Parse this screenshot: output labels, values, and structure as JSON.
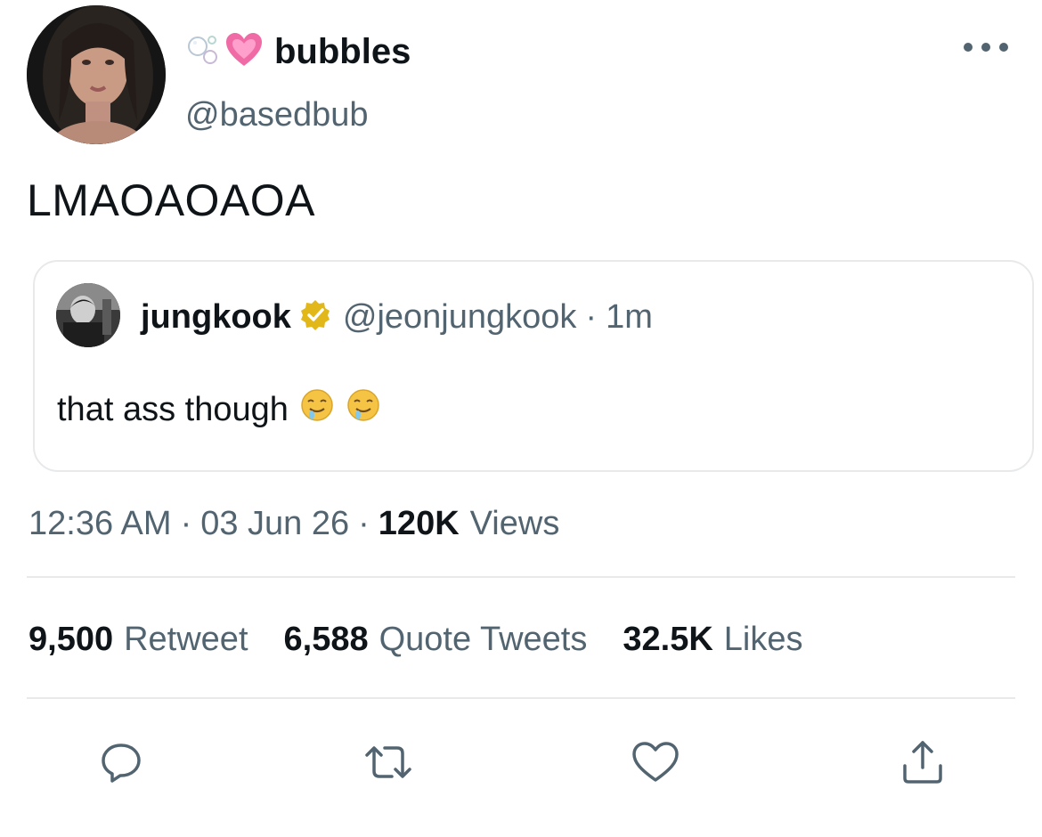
{
  "author": {
    "display_name": "bubbles",
    "handle": "@basedbub",
    "name_emojis": [
      "bubbles-emoji",
      "growing-heart-emoji"
    ]
  },
  "tweet": {
    "text": "LMAOAOAOA"
  },
  "quoted_tweet": {
    "display_name": "jungkook",
    "verified": true,
    "handle": "@jeonjungkook",
    "separator": "·",
    "time": "1m",
    "text": "that ass though",
    "emojis": [
      "drooling-face-emoji",
      "drooling-face-emoji"
    ]
  },
  "meta": {
    "time": "12:36 AM",
    "separator": "·",
    "date": "03 Jun 26",
    "views_count": "120K",
    "views_label": "Views"
  },
  "stats": {
    "retweets_count": "9,500",
    "retweets_label": "Retweet",
    "quotes_count": "6,588",
    "quotes_label": "Quote Tweets",
    "likes_count": "32.5K",
    "likes_label": "Likes"
  },
  "colors": {
    "text_primary": "#0f1419",
    "text_secondary": "#536471",
    "border": "#e7e9ea",
    "verified_gold": "#e2b719"
  },
  "actions": [
    "reply-icon",
    "retweet-icon",
    "like-icon",
    "share-icon"
  ]
}
